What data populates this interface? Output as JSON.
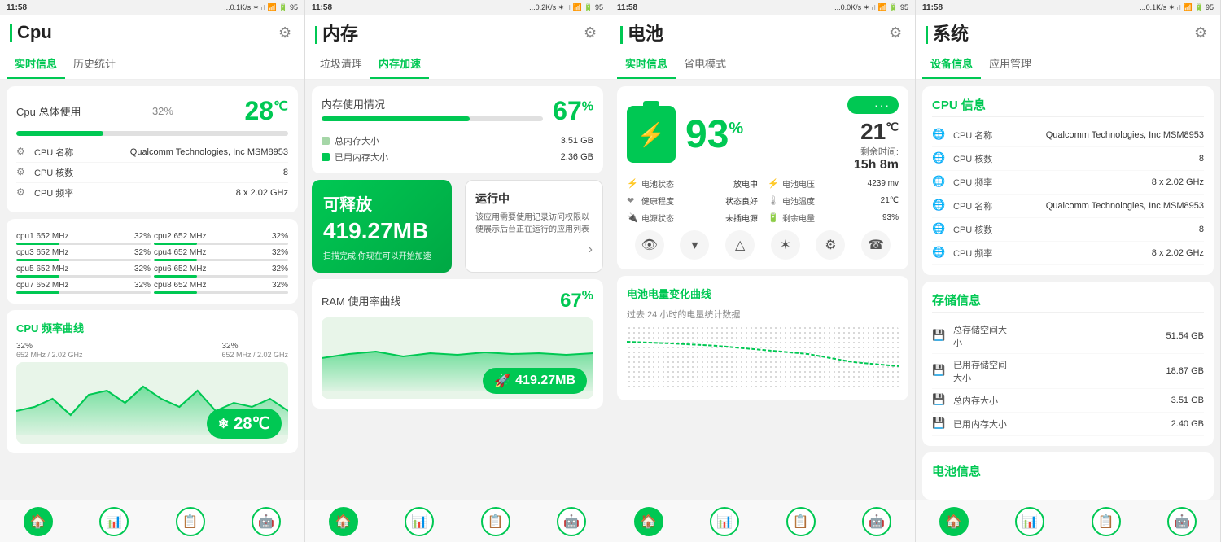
{
  "panels": [
    {
      "id": "cpu",
      "statusBar": {
        "time": "11:58",
        "signal": "...0.1K/s ✶ ⑁ 📶 🔋 95"
      },
      "header": {
        "title": "Cpu",
        "hasGear": true
      },
      "tabs": [
        {
          "label": "实时信息",
          "active": true
        },
        {
          "label": "历史统计",
          "active": false
        }
      ],
      "usageCard": {
        "label": "Cpu 总体使用",
        "percent": "32%",
        "progressValue": 32,
        "temperature": "28",
        "tempUnit": "℃"
      },
      "cpuInfo": [
        {
          "icon": "⚙",
          "label": "CPU 名称",
          "value": "Qualcomm Technologies, Inc MSM8953"
        },
        {
          "icon": "⚙",
          "label": "CPU 核数",
          "value": "8"
        },
        {
          "icon": "⚙",
          "label": "CPU 频率",
          "value": "8 x 2.02 GHz"
        }
      ],
      "cores": [
        {
          "name": "cpu1",
          "freq": "652 MHz",
          "pct": "32%",
          "val": 32
        },
        {
          "name": "cpu2",
          "freq": "652 MHz",
          "pct": "32%",
          "val": 32
        },
        {
          "name": "cpu3",
          "freq": "652 MHz",
          "pct": "32%",
          "val": 32
        },
        {
          "name": "cpu4",
          "freq": "652 MHz",
          "pct": "32%",
          "val": 32
        },
        {
          "name": "cpu5",
          "freq": "652 MHz",
          "pct": "32%",
          "val": 32
        },
        {
          "name": "cpu6",
          "freq": "652 MHz",
          "pct": "32%",
          "val": 32
        },
        {
          "name": "cpu7",
          "freq": "652 MHz",
          "pct": "32%",
          "val": 32
        },
        {
          "name": "cpu8",
          "freq": "652 MHz",
          "pct": "32%",
          "val": 32
        }
      ],
      "chartTitle": "CPU 频率曲线",
      "chartLabels": [
        {
          "pct": "32%",
          "freq": "652 MHz / 2.02 GHz"
        },
        {
          "pct": "32%",
          "freq": "652 MHz / 2.02 GHz"
        }
      ],
      "tempBadge": "28℃"
    },
    {
      "id": "memory",
      "statusBar": {
        "time": "11:58",
        "signal": "...0.2K/s ✶ ⑁ 📶 🔋 95"
      },
      "header": {
        "title": "内存",
        "hasGear": true
      },
      "tabs": [
        {
          "label": "垃圾清理",
          "active": false
        },
        {
          "label": "内存加速",
          "active": true
        }
      ],
      "usageCard": {
        "label": "内存使用情况",
        "percent": "67",
        "percentSuffix": "%",
        "progressValue": 67,
        "totalLabel": "总内存大小",
        "totalValue": "3.51 GB",
        "usedLabel": "已用内存大小",
        "usedValue": "2.36 GB"
      },
      "releaseCard": {
        "title": "可释放",
        "amount": "419.27MB",
        "desc": "扫描完成,你现在可以开始加速"
      },
      "runningCard": {
        "title": "运行中",
        "desc": "该应用需要使用记录访问权限以便展示后台正在运行的应用列表"
      },
      "ramChart": {
        "title": "RAM 使用率曲线",
        "percent": "67",
        "percentSuffix": "%",
        "badge": "419.27MB"
      }
    },
    {
      "id": "battery",
      "statusBar": {
        "time": "11:58",
        "signal": "...0.0K/s ✶ ⑁ 📶 🔋 95"
      },
      "header": {
        "title": "电池",
        "hasGear": true
      },
      "tabs": [
        {
          "label": "实时信息",
          "active": true
        },
        {
          "label": "省电模式",
          "active": false
        }
      ],
      "batteryMain": {
        "percent": "93",
        "percentSuffix": "%",
        "temperature": "21",
        "tempUnit": "℃",
        "timeLeftLabel": "剩余时间:",
        "timeLeftValue": "15h 8m"
      },
      "batteryInfo": [
        {
          "icon": "⚡",
          "label": "电池状态",
          "value": "放电中",
          "side": "left"
        },
        {
          "icon": "⚡",
          "label": "电池电压",
          "value": "4239 mv",
          "side": "right"
        },
        {
          "icon": "❤",
          "label": "健康程度",
          "value": "状态良好",
          "side": "left"
        },
        {
          "icon": "🌡",
          "label": "电池温度",
          "value": "21℃",
          "side": "right"
        },
        {
          "icon": "🔌",
          "label": "电源状态",
          "value": "未插电源",
          "side": "left"
        },
        {
          "icon": "🔋",
          "label": "剩余电量",
          "value": "93%",
          "side": "right"
        }
      ],
      "icons": [
        "👁",
        "▾",
        "△",
        "✶",
        "⚙",
        "☎"
      ],
      "chartTitle": "电池电量变化曲线",
      "chartSubtitle": "过去 24 小时的电量统计数据"
    },
    {
      "id": "system",
      "statusBar": {
        "time": "11:58",
        "signal": "...0.1K/s ✶ ⑁ 📶 🔋 95"
      },
      "header": {
        "title": "系统",
        "hasGear": true
      },
      "tabs": [
        {
          "label": "设备信息",
          "active": true
        },
        {
          "label": "应用管理",
          "active": false
        }
      ],
      "cpuSection": {
        "title": "CPU 信息",
        "items": [
          {
            "icon": "🌐",
            "label": "CPU 名称",
            "value": "Qualcomm Technologies, Inc MSM8953"
          },
          {
            "icon": "🌐",
            "label": "CPU 核数",
            "value": "8"
          },
          {
            "icon": "🌐",
            "label": "CPU 频率",
            "value": "8 x 2.02 GHz"
          },
          {
            "icon": "🌐",
            "label": "CPU 名称",
            "value": "Qualcomm Technologies, Inc MSM8953"
          },
          {
            "icon": "🌐",
            "label": "CPU 核数",
            "value": "8"
          },
          {
            "icon": "🌐",
            "label": "CPU 频率",
            "value": "8 x 2.02 GHz"
          }
        ]
      },
      "storageSection": {
        "title": "存储信息",
        "items": [
          {
            "icon": "💾",
            "label": "总存储空间大小",
            "value": "51.54 GB"
          },
          {
            "icon": "💾",
            "label": "已用存储空间大小",
            "value": "18.67 GB"
          },
          {
            "icon": "💾",
            "label": "总内存大小",
            "value": "3.51 GB"
          },
          {
            "icon": "💾",
            "label": "已用内存大小",
            "value": "2.40 GB"
          }
        ]
      },
      "batterySection": {
        "title": "电池信息"
      }
    }
  ],
  "bottomNav": {
    "icons": [
      "🏠",
      "📊",
      "📋",
      "🤖"
    ]
  }
}
